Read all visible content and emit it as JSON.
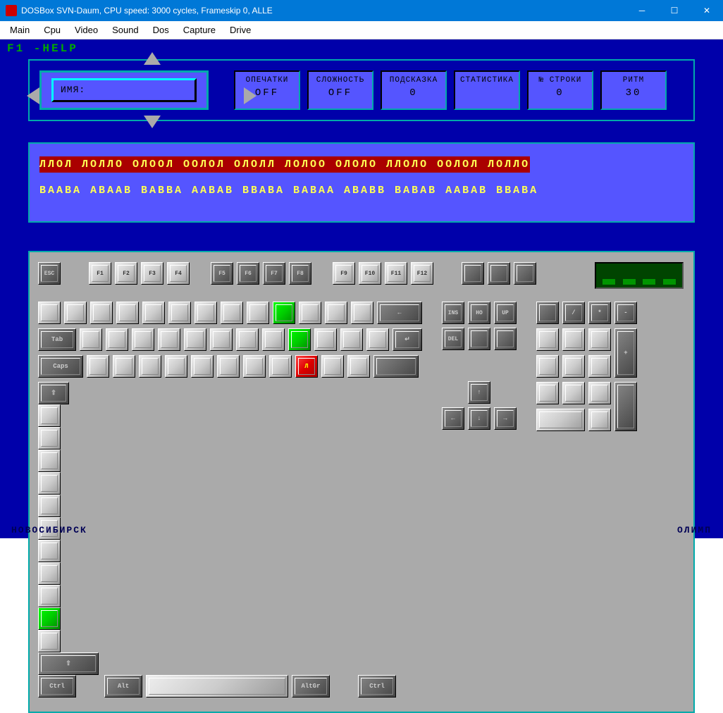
{
  "window": {
    "title": "DOSBox SVN-Daum, CPU speed:     3000 cycles, Frameskip  0,     ALLE"
  },
  "menubar": {
    "items": [
      "Main",
      "Cpu",
      "Video",
      "Sound",
      "Dos",
      "Capture",
      "Drive"
    ]
  },
  "help_line": "F1 -HELP",
  "name_field": {
    "label": "ИМЯ:"
  },
  "stats": [
    {
      "label": "ОПЕЧАТКИ",
      "value": "OFF"
    },
    {
      "label": "СЛОЖНОСТЬ",
      "value": "OFF"
    },
    {
      "label": "ПОДСКАЗКА",
      "value": "0"
    },
    {
      "label": "СТАТИСТИКА",
      "value": ""
    },
    {
      "label": "№ СТРОКИ",
      "value": "0"
    },
    {
      "label": "РИТМ",
      "value": "30"
    }
  ],
  "typing": {
    "current": "ЛЛОЛ ЛОЛЛО ОЛООЛ ООЛОЛ ОЛОЛЛ ЛОЛОО ОЛОЛО ЛЛОЛО ООЛОЛ ЛОЛЛО",
    "next": "ВААВА АВААВ ВАВВА ААВАВ ВВАВА ВАВАА АВАВВ ВАВАВ ААВАВ ВВАВА"
  },
  "fkeys_left": [
    "F1",
    "F2",
    "F3",
    "F4"
  ],
  "fkeys_mid": [
    "F5",
    "F6",
    "F7",
    "F8"
  ],
  "fkeys_right": [
    "F9",
    "F10",
    "F11",
    "F12"
  ],
  "key_esc": "ESC",
  "key_tab": "Tab",
  "key_caps": "Caps",
  "key_ctrl": "Ctrl",
  "key_alt": "Alt",
  "key_altgr": "AltGr",
  "key_highlight": "Л",
  "nav_keys_r1": [
    "INS",
    "HO",
    "UP"
  ],
  "nav_keys_r2": [
    "DEL",
    "",
    ""
  ],
  "numpad_r1": [
    "",
    "/",
    "*",
    "-"
  ],
  "footer": {
    "left": "НОВОСИБИРСК",
    "right": "ОЛИМП"
  }
}
